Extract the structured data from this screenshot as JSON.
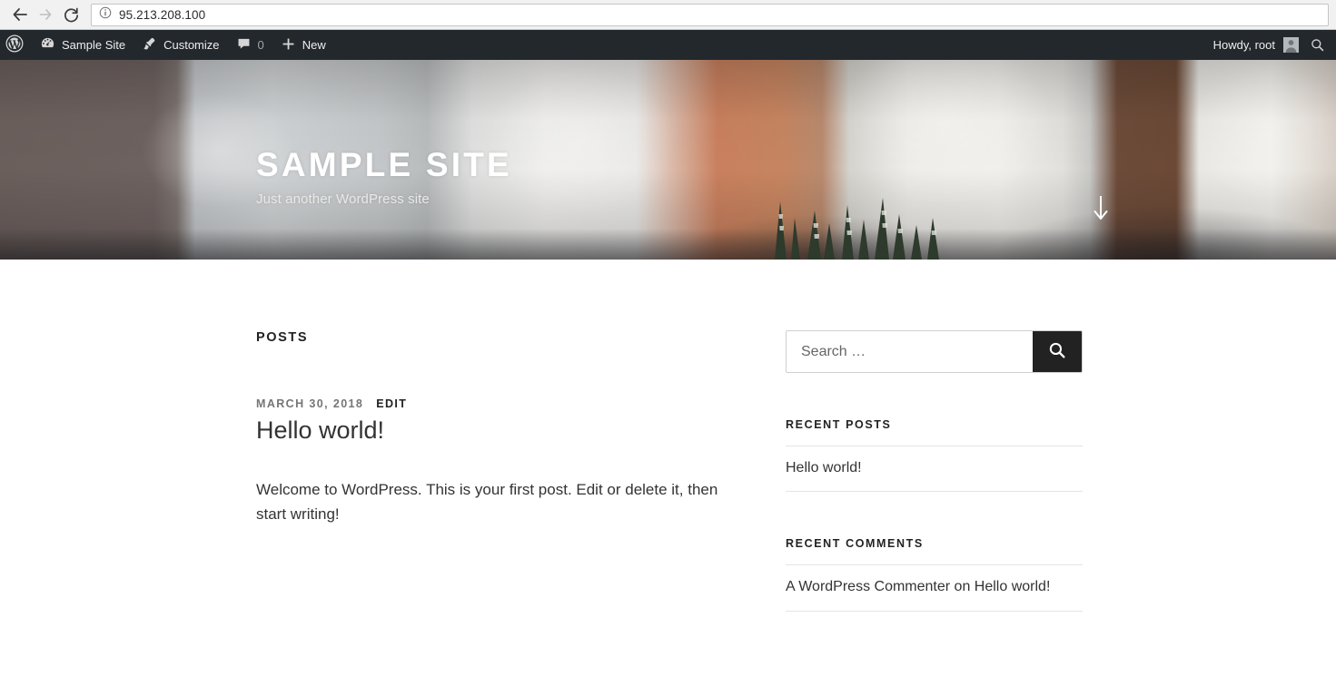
{
  "browser": {
    "url": "95.213.208.100",
    "back_label": "Back",
    "forward_label": "Forward",
    "reload_label": "Reload",
    "info_label": "Site information"
  },
  "adminbar": {
    "logo_label": "About WordPress",
    "site_name": "Sample Site",
    "customize": "Customize",
    "comments_count": "0",
    "new": "New",
    "howdy": "Howdy, root",
    "search_label": "Search",
    "avatar_label": "root"
  },
  "hero": {
    "title": "Sample Site",
    "tagline": "Just another WordPress site",
    "scroll_label": "Scroll down to content"
  },
  "main": {
    "posts_heading": "Posts",
    "post": {
      "date": "March 30, 2018",
      "edit_label": "Edit",
      "title": "Hello world!",
      "excerpt": "Welcome to WordPress. This is your first post. Edit or delete it, then start writing!"
    }
  },
  "sidebar": {
    "search": {
      "placeholder": "Search …",
      "value": "",
      "submit_label": "Search"
    },
    "recent_posts": {
      "title": "Recent Posts",
      "items": [
        {
          "label": "Hello world!"
        }
      ]
    },
    "recent_comments": {
      "title": "Recent Comments",
      "items": [
        {
          "author": "A WordPress Commenter",
          "connector": "on",
          "post": "Hello world!"
        }
      ]
    }
  },
  "colors": {
    "adminbar_bg": "#23282d",
    "search_button_bg": "#222222",
    "text": "#333333",
    "meta_text": "#767676",
    "divider": "#e4e4e4"
  }
}
